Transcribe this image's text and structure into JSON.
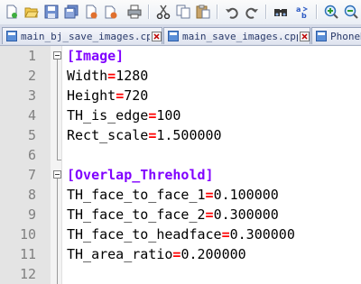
{
  "toolbar": {
    "buttons": [
      "new-file-icon",
      "open-file-icon",
      "save-icon",
      "save-all-icon",
      "close-icon",
      "close-all-icon",
      "print-icon",
      "cut-icon",
      "copy-icon",
      "paste-icon",
      "undo-icon",
      "redo-icon",
      "find-icon",
      "replace-icon",
      "zoom-in-icon",
      "zoom-out-icon"
    ]
  },
  "tabs": [
    {
      "label": "main_bj_save_images.cpp"
    },
    {
      "label": "main_save_images.cpp"
    },
    {
      "label": "PhoneD"
    }
  ],
  "editor": {
    "lines": [
      {
        "num": "1",
        "section": "[Image]",
        "key": "",
        "eq": "",
        "value": ""
      },
      {
        "num": "2",
        "section": "",
        "key": "Width",
        "eq": "=",
        "value": "1280"
      },
      {
        "num": "3",
        "section": "",
        "key": "Height",
        "eq": "=",
        "value": "720"
      },
      {
        "num": "4",
        "section": "",
        "key": "TH_is_edge",
        "eq": "=",
        "value": "100"
      },
      {
        "num": "5",
        "section": "",
        "key": "Rect_scale",
        "eq": "=",
        "value": "1.500000"
      },
      {
        "num": "6",
        "section": "",
        "key": "",
        "eq": "",
        "value": ""
      },
      {
        "num": "7",
        "section": "[Overlap_Threhold]",
        "key": "",
        "eq": "",
        "value": ""
      },
      {
        "num": "8",
        "section": "",
        "key": "TH_face_to_face_1",
        "eq": "=",
        "value": "0.100000"
      },
      {
        "num": "9",
        "section": "",
        "key": "TH_face_to_face_2",
        "eq": "=",
        "value": "0.300000"
      },
      {
        "num": "10",
        "section": "",
        "key": "TH_face_to_headface",
        "eq": "=",
        "value": "0.300000"
      },
      {
        "num": "11",
        "section": "",
        "key": "TH_area_ratio",
        "eq": "=",
        "value": "0.200000"
      },
      {
        "num": "12",
        "section": "",
        "key": "",
        "eq": "",
        "value": ""
      }
    ]
  },
  "colors": {
    "section": "#8000ff",
    "equals": "#ff0000",
    "line_number": "#808080",
    "gutter": "#e4e4e4"
  }
}
